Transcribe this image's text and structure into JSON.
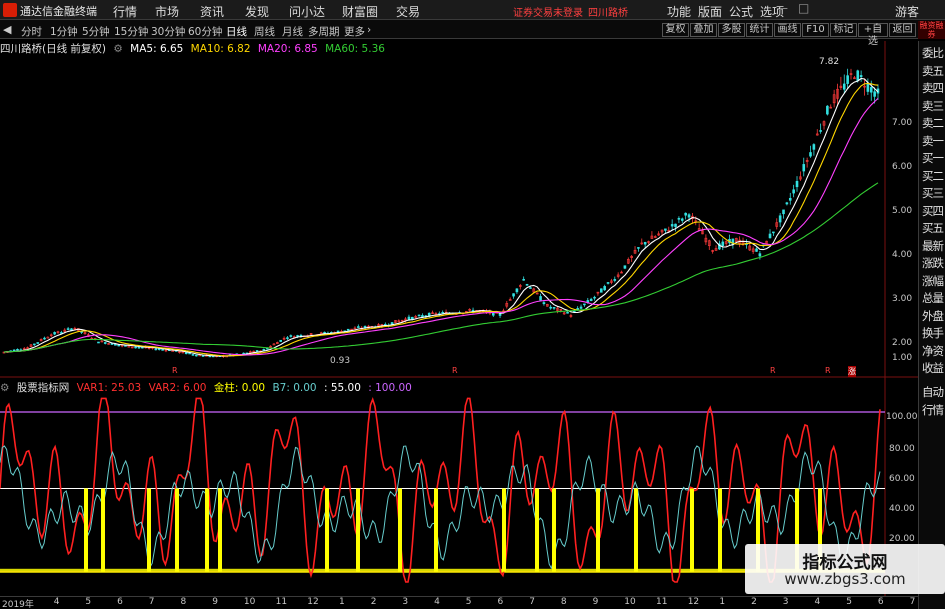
{
  "app": {
    "name": "通达信金融终端",
    "menu": [
      "行情",
      "市场",
      "资讯",
      "发现",
      "问小达",
      "财富圈",
      "交易"
    ],
    "login_msg": "证券交易未登录",
    "stock": "四川路桥",
    "right_menu": [
      "功能",
      "版面",
      "公式",
      "选项"
    ],
    "guest": "游客"
  },
  "toolbar": {
    "periods": [
      "分时",
      "1分钟",
      "5分钟",
      "15分钟",
      "30分钟",
      "60分钟",
      "日线",
      "周线",
      "月线",
      "多周期",
      "更多"
    ],
    "active_period": "日线",
    "right_buttons": [
      "复权",
      "叠加",
      "多股",
      "统计",
      "画线",
      "F10",
      "标记",
      "+自选",
      "返回"
    ]
  },
  "badge": "融资融券",
  "main_chart": {
    "title": "四川路桥(日线 前复权)",
    "ma": [
      {
        "label": "MA5: 6.65",
        "color": "#ffffff"
      },
      {
        "label": "MA10: 6.82",
        "color": "#ffd700"
      },
      {
        "label": "MA20: 6.85",
        "color": "#ff40ff"
      },
      {
        "label": "MA60: 5.36",
        "color": "#33cc33"
      }
    ],
    "y_ticks": [
      "7.00",
      "6.00",
      "5.00",
      "4.00",
      "3.00",
      "2.00",
      "1.00"
    ],
    "high_label": "7.82",
    "low_label": "0.93",
    "event_markers": [
      "R",
      "R",
      "R",
      "R",
      "涨"
    ]
  },
  "sub_chart": {
    "title": "股票指标网",
    "items": [
      {
        "label": "VAR1: 25.03",
        "color": "#ff3030"
      },
      {
        "label": "VAR2: 6.00",
        "color": "#ff3030"
      },
      {
        "label": "金柱: 0.00",
        "color": "#ffff00"
      },
      {
        "label": "B7: 0.00",
        "color": "#66cccc"
      },
      {
        "label": ": 55.00",
        "color": "#ffffff"
      },
      {
        "label": ": 100.00",
        "color": "#cc66ff"
      }
    ],
    "y_ticks": [
      "100.00",
      "80.00",
      "60.00",
      "40.00",
      "20.00"
    ]
  },
  "x_axis": [
    "2019年",
    "4",
    "5",
    "6",
    "7",
    "8",
    "9",
    "10",
    "11",
    "12",
    "1",
    "2",
    "3",
    "4",
    "5",
    "6",
    "7",
    "8",
    "9",
    "10",
    "11",
    "12",
    "1",
    "2",
    "3",
    "4",
    "5",
    "6",
    "7"
  ],
  "sidebar": [
    "委比",
    "卖五",
    "卖四",
    "卖三",
    "卖二",
    "卖一",
    "买一",
    "买二",
    "买三",
    "买四",
    "买五",
    "最新",
    "涨跌",
    "涨幅",
    "总量",
    "外盘",
    "换手",
    "净资",
    "收益",
    "自动",
    "行情"
  ],
  "watermark": {
    "line1": "指标公式网",
    "line2": "www.zbgs3.com"
  },
  "chart_data": [
    {
      "type": "candlestick",
      "title": "四川路桥(日线 前复权)",
      "series": [
        {
          "name": "MA5",
          "value": 6.65
        },
        {
          "name": "MA10",
          "value": 6.82
        },
        {
          "name": "MA20",
          "value": 6.85
        },
        {
          "name": "MA60",
          "value": 5.36
        }
      ],
      "approx_close_path": [
        1.15,
        1.25,
        1.55,
        1.7,
        1.4,
        1.3,
        1.25,
        1.2,
        1.1,
        1.05,
        1.1,
        1.2,
        1.5,
        1.55,
        1.6,
        1.7,
        1.75,
        1.9,
        2.0,
        2.05,
        2.1,
        2.0,
        2.8,
        2.2,
        2.0,
        2.4,
        2.9,
        3.6,
        3.9,
        4.3,
        3.5,
        3.7,
        3.4,
        4.3,
        5.5,
        6.8,
        7.5,
        7.0
      ],
      "ylim": [
        0.7,
        7.9
      ]
    },
    {
      "type": "line",
      "title": "股票指标网",
      "series": [
        {
          "name": "VAR1",
          "value": 25.03
        },
        {
          "name": "VAR2",
          "value": 6.0
        },
        {
          "name": "金柱",
          "value": 0.0
        },
        {
          "name": "B7",
          "value": 0.0
        }
      ],
      "reference_lines": [
        55,
        100
      ],
      "ylim": [
        0,
        110
      ]
    }
  ]
}
